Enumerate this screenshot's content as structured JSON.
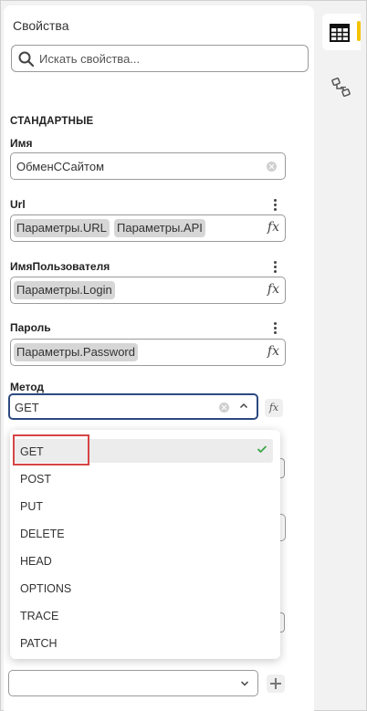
{
  "panel": {
    "title": "Свойства",
    "search_placeholder": "Искать свойства...",
    "section": "СТАНДАРТНЫЕ"
  },
  "fields": {
    "name": {
      "label": "Имя",
      "value": "ОбменССайтом"
    },
    "url": {
      "label": "Url",
      "chips": [
        "Параметры.URL",
        "Параметры.API"
      ]
    },
    "username": {
      "label": "ИмяПользователя",
      "chips": [
        "Параметры.Login"
      ]
    },
    "password": {
      "label": "Пароль",
      "chips": [
        "Параметры.Password"
      ]
    },
    "method": {
      "label": "Метод",
      "value": "GET"
    }
  },
  "dropdown": {
    "options": [
      "GET",
      "POST",
      "PUT",
      "DELETE",
      "HEAD",
      "OPTIONS",
      "TRACE",
      "PATCH"
    ],
    "selected": "GET"
  },
  "icons": {
    "search": "search-icon",
    "fx": "fx",
    "table": "table-icon",
    "schema": "schema-icon",
    "check": "check-icon"
  },
  "colors": {
    "accent": "#f5c400",
    "focus_border": "#2b4a80",
    "check": "#3aa648",
    "highlight": "#d64545"
  }
}
